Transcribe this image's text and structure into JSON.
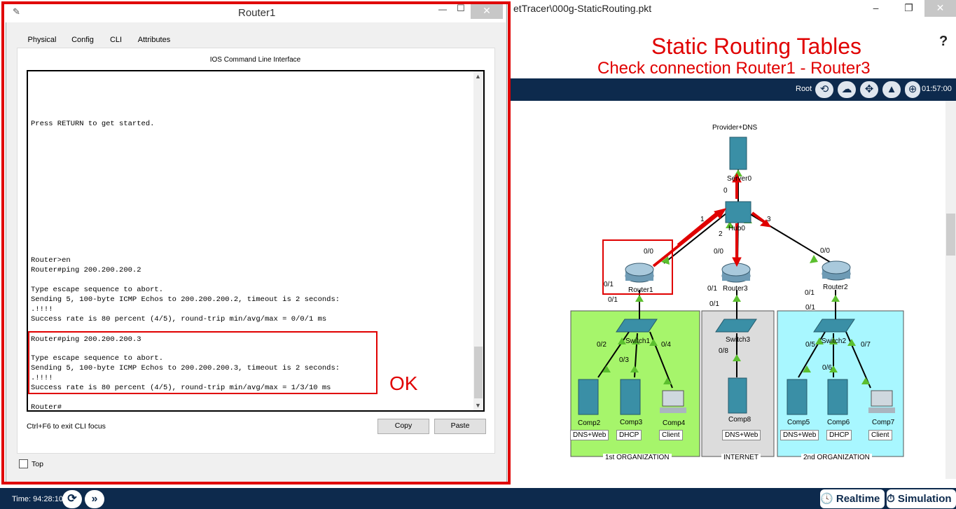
{
  "app": {
    "title": "etTracer\\000g-StaticRouting.pkt",
    "minimize": "–",
    "restore": "❐",
    "close": "✕"
  },
  "annotation": {
    "title": "Static Routing Tables",
    "subtitle": "Check connection Router1 - Router3",
    "ok": "OK"
  },
  "toolbar": {
    "root": "Root",
    "clock": "01:57:00",
    "help": "?",
    "icons": [
      "back-icon",
      "cloud-icon",
      "move-icon",
      "background-icon",
      "network-icon"
    ]
  },
  "dialog": {
    "title": "Router1",
    "tabs": [
      "Physical",
      "Config",
      "CLI",
      "Attributes"
    ],
    "active_tab": "CLI",
    "heading": "IOS Command Line Interface",
    "cli_lines": [
      "Press RETURN to get started.",
      "Router>en",
      "Router#ping 200.200.200.2",
      "",
      "Type escape sequence to abort.",
      "Sending 5, 100-byte ICMP Echos to 200.200.200.2, timeout is 2 seconds:",
      ".!!!!",
      "Success rate is 80 percent (4/5), round-trip min/avg/max = 0/0/1 ms",
      "",
      "Router#ping 200.200.200.3",
      "",
      "Type escape sequence to abort.",
      "Sending 5, 100-byte ICMP Echos to 200.200.200.3, timeout is 2 seconds:",
      ".!!!!",
      "Success rate is 80 percent (4/5), round-trip min/avg/max = 1/3/10 ms",
      "",
      "Router#"
    ],
    "hint": "Ctrl+F6 to exit CLI focus",
    "copy": "Copy",
    "paste": "Paste",
    "top": "Top"
  },
  "topology": {
    "server_top": "Provider+DNS",
    "server0": "Server0",
    "hub": "Hub0",
    "routers": [
      "Router1",
      "Router3",
      "Router2"
    ],
    "switches": [
      "Switch1",
      "Switch3",
      "Switch2"
    ],
    "comps": [
      "Comp2",
      "Comp3",
      "Comp4",
      "Comp8",
      "Comp5",
      "Comp6",
      "Comp7"
    ],
    "roles": [
      "DNS+Web",
      "DHCP",
      "Client",
      "DNS+Web",
      "DNS+Web",
      "DHCP",
      "Client"
    ],
    "ports": [
      "0",
      "1",
      "2",
      "3",
      "0/0",
      "0/0",
      "0/0",
      "0/1",
      "0/1",
      "0/1",
      "0/1",
      "0/1",
      "0/1",
      "0/2",
      "0/3",
      "0/4",
      "0/8",
      "0/5",
      "0/6",
      "0/7"
    ],
    "areas": [
      "1st ORGANIZATION",
      "INTERNET",
      "2nd ORGANIZATION"
    ]
  },
  "status": {
    "time": "Time: 94:28:10",
    "realtime": "Realtime",
    "simulation": "Simulation"
  }
}
